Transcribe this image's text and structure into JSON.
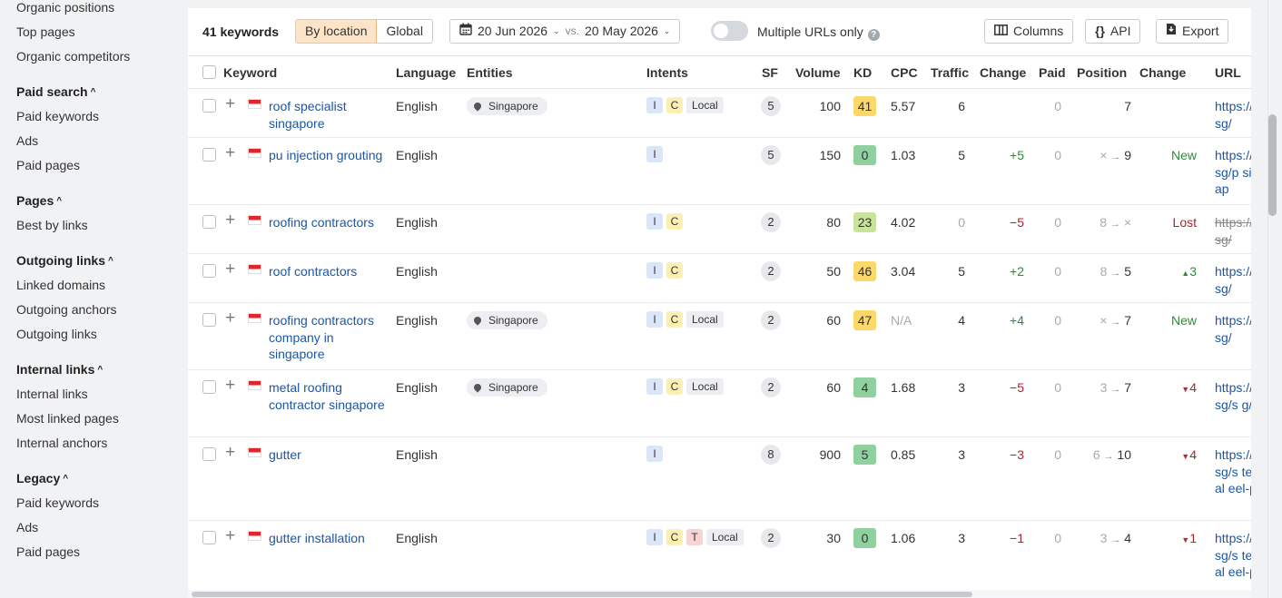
{
  "sidebar": {
    "organic_positions": "Organic positions",
    "top_pages": "Top pages",
    "organic_competitors": "Organic competitors",
    "paid_search": "Paid search",
    "paid_keywords": "Paid keywords",
    "ads": "Ads",
    "paid_pages": "Paid pages",
    "pages": "Pages",
    "best_by_links": "Best by links",
    "outgoing_links_head": "Outgoing links",
    "linked_domains": "Linked domains",
    "outgoing_anchors": "Outgoing anchors",
    "outgoing_links": "Outgoing links",
    "internal_links_head": "Internal links",
    "internal_links": "Internal links",
    "most_linked_pages": "Most linked pages",
    "internal_anchors": "Internal anchors",
    "legacy": "Legacy",
    "legacy_paid_keywords": "Paid keywords",
    "legacy_ads": "Ads",
    "legacy_paid_pages": "Paid pages",
    "chevron": "^"
  },
  "toolbar": {
    "count": "41 keywords",
    "by_location": "By location",
    "global": "Global",
    "date_from": "20 Jun 2026",
    "vs": "vs.",
    "date_to": "20 May 2026",
    "multiple_urls": "Multiple URLs only",
    "help": "?",
    "columns": "Columns",
    "api": "API",
    "export": "Export",
    "api_icon": "{}"
  },
  "headers": {
    "keyword": "Keyword",
    "language": "Language",
    "entities": "Entities",
    "intents": "Intents",
    "sf": "SF",
    "volume": "Volume",
    "kd": "KD",
    "cpc": "CPC",
    "traffic": "Traffic",
    "change": "Change",
    "paid": "Paid",
    "position": "Position",
    "pos_change": "Change",
    "url": "URL"
  },
  "icons": {
    "plus": "+",
    "arrow": "→",
    "cross": "×",
    "up": "▲",
    "down": "▼"
  },
  "colors": {
    "accent": "#fde3c8",
    "link": "#1a56a8",
    "kd_green": "#8fd19e",
    "kd_lightgreen": "#c8e49a",
    "kd_yellow": "#fbd86a",
    "positive": "#2e8b3a",
    "negative": "#b0232a"
  },
  "rows": [
    {
      "keyword": "roof specialist singapore",
      "language": "English",
      "entity": "Singapore",
      "intents": [
        "I",
        "C",
        "Local"
      ],
      "sf": "5",
      "volume": "100",
      "kd": "41",
      "kd_color": "#fbd86a",
      "cpc": "5.57",
      "traffic": "6",
      "change": "",
      "paid": "0",
      "pos_from": "",
      "pos_to": "7",
      "pos_change": "",
      "url": "https://m.sg/"
    },
    {
      "keyword": "pu injection grouting",
      "language": "English",
      "entity": "",
      "intents": [
        "I"
      ],
      "sf": "5",
      "volume": "150",
      "kd": "0",
      "kd_color": "#8fd19e",
      "cpc": "1.03",
      "traffic": "5",
      "change": "+5",
      "paid": "0",
      "pos_from": "×",
      "pos_to": "9",
      "pos_change": "New",
      "url": "https://m.sg/p singap"
    },
    {
      "keyword": "roofing contractors",
      "language": "English",
      "entity": "",
      "intents": [
        "I",
        "C"
      ],
      "sf": "2",
      "volume": "80",
      "kd": "23",
      "kd_color": "#c8e49a",
      "cpc": "4.02",
      "traffic": "0",
      "change": "−5",
      "paid": "0",
      "pos_from": "8",
      "pos_to": "×",
      "pos_change": "Lost",
      "url": "https://m.sg/"
    },
    {
      "keyword": "roof contractors",
      "language": "English",
      "entity": "",
      "intents": [
        "I",
        "C"
      ],
      "sf": "2",
      "volume": "50",
      "kd": "46",
      "kd_color": "#fbd86a",
      "cpc": "3.04",
      "traffic": "5",
      "change": "+2",
      "paid": "0",
      "pos_from": "8",
      "pos_to": "5",
      "pos_change": "3",
      "url": "https://m.sg/"
    },
    {
      "keyword": "roofing contractors company in singapore",
      "language": "English",
      "entity": "Singapore",
      "intents": [
        "I",
        "C",
        "Local"
      ],
      "sf": "2",
      "volume": "60",
      "kd": "47",
      "kd_color": "#fbd86a",
      "cpc": "N/A",
      "traffic": "4",
      "change": "+4",
      "paid": "0",
      "pos_from": "×",
      "pos_to": "7",
      "pos_change": "New",
      "url": "https://m.sg/"
    },
    {
      "keyword": "metal roofing contractor singapore",
      "language": "English",
      "entity": "Singapore",
      "intents": [
        "I",
        "C",
        "Local"
      ],
      "sf": "2",
      "volume": "60",
      "kd": "4",
      "kd_color": "#8fd19e",
      "cpc": "1.68",
      "traffic": "3",
      "change": "−5",
      "paid": "0",
      "pos_from": "3",
      "pos_to": "7",
      "pos_change": "4",
      "url": "https://m.sg/s g/"
    },
    {
      "keyword": "gutter",
      "language": "English",
      "entity": "",
      "intents": [
        "I"
      ],
      "sf": "8",
      "volume": "900",
      "kd": "5",
      "kd_color": "#8fd19e",
      "cpc": "0.85",
      "traffic": "3",
      "change": "−3",
      "paid": "0",
      "pos_from": "6",
      "pos_to": "10",
      "pos_change": "4",
      "url": "https://m.sg/s teel-al eel-pv"
    },
    {
      "keyword": "gutter installation",
      "language": "English",
      "entity": "",
      "intents": [
        "I",
        "C",
        "T",
        "Local"
      ],
      "sf": "2",
      "volume": "30",
      "kd": "0",
      "kd_color": "#8fd19e",
      "cpc": "1.06",
      "traffic": "3",
      "change": "−1",
      "paid": "0",
      "pos_from": "3",
      "pos_to": "4",
      "pos_change": "1",
      "url": "https://m.sg/s teel-al eel-pv"
    }
  ]
}
